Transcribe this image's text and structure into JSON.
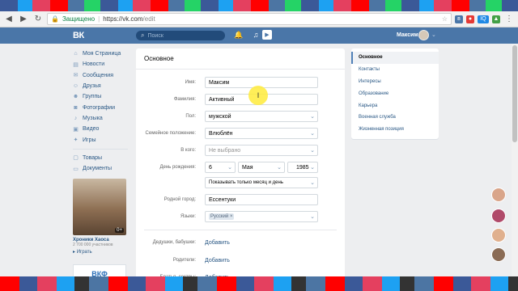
{
  "browser": {
    "secure_label": "Защищено",
    "url_host": "https://vk.com",
    "url_path": "/edit",
    "ext_label": "IQ"
  },
  "header": {
    "logo": "ВК",
    "search_placeholder": "Поиск",
    "user_name": "Максим"
  },
  "left_menu": {
    "items": [
      "Моя Страница",
      "Новости",
      "Сообщения",
      "Друзья",
      "Группы",
      "Фотографии",
      "Музыка",
      "Видео",
      "Игры"
    ],
    "extra": [
      "Товары",
      "Документы"
    ],
    "ad": {
      "title": "Хроники Хаоса",
      "subtitle": "2 700 000 участников",
      "play": "Играть",
      "badge": "0+"
    }
  },
  "panel": {
    "title": "Основное",
    "first_name_label": "Имя:",
    "first_name": "Максим",
    "last_name_label": "Фамилия:",
    "last_name": "Активный",
    "sex_label": "Пол:",
    "sex": "мужской",
    "marital_label": "Семейное положение:",
    "marital": "Влюблён",
    "partner_label": "В кого:",
    "partner": "Не выбрано",
    "birthday_label": "День рождения:",
    "bday_day": "6",
    "bday_month": "Мая",
    "bday_year": "1985",
    "bday_visibility": "Показывать только месяц и день",
    "hometown_label": "Родной город:",
    "hometown": "Ессентуки",
    "languages_label": "Языки:",
    "language_tag": "Русский",
    "grandparents_label": "Дедушки, бабушки:",
    "parents_label": "Родители:",
    "siblings_label": "Братья, сестры:",
    "add_link": "Добавить"
  },
  "right_menu": {
    "items": [
      "Основное",
      "Контакты",
      "Интересы",
      "Образование",
      "Карьера",
      "Военная служба",
      "Жизненная позиция"
    ]
  },
  "colors": {
    "vk_blue": "#4a76a8",
    "link": "#2a5885",
    "bg": "#edeef0"
  }
}
